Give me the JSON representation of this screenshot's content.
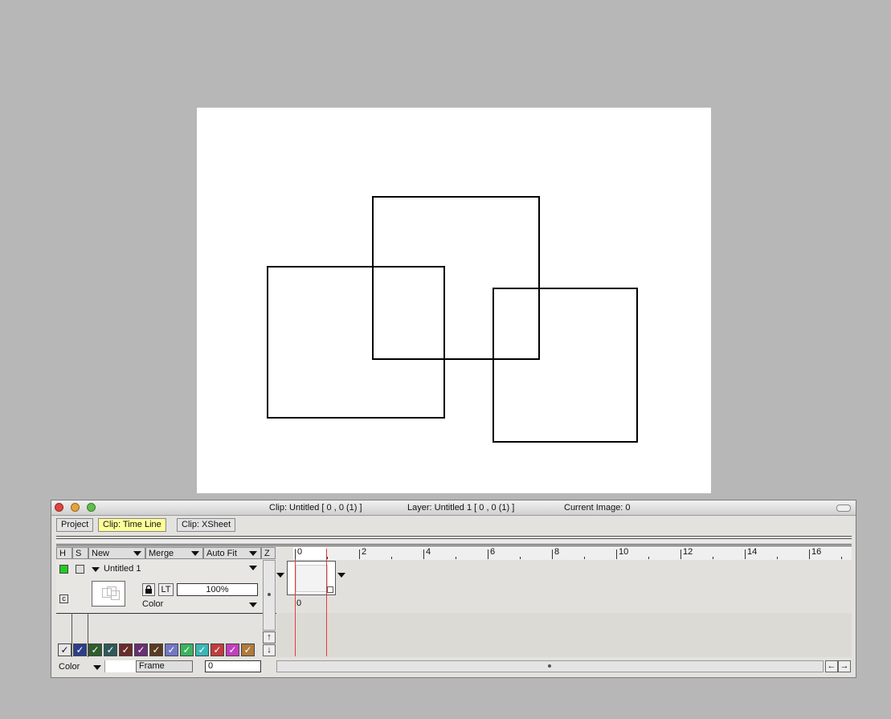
{
  "canvas": {
    "background": "#ffffff",
    "stroke": "#000000"
  },
  "window": {
    "title_clip": "Clip: Untitled [ 0 , 0  (1) ]",
    "title_layer": "Layer: Untitled 1 [ 0 , 0  (1) ]",
    "title_image": "Current Image: 0"
  },
  "tabs": [
    {
      "label": "Project"
    },
    {
      "label": "Clip: Time Line"
    },
    {
      "label": "Clip: XSheet"
    }
  ],
  "columns": {
    "h": "H",
    "s": "S",
    "new": "New",
    "merge": "Merge",
    "autofit": "Auto Fit",
    "z": "Z"
  },
  "layer": {
    "name": "Untitled 1",
    "lock_icon": "lock-icon",
    "lt_label": "LT",
    "opacity": "100%",
    "mode": "Color",
    "c_badge": "c",
    "visible_color": "#22cc22"
  },
  "ruler": {
    "labels": [
      "0",
      "2",
      "4",
      "6",
      "8",
      "10",
      "12",
      "14",
      "16"
    ]
  },
  "cel": {
    "frame_label": "0"
  },
  "swatches": [
    "#e6e6e6",
    "#2c3e8a",
    "#2e5e2e",
    "#2e5a5a",
    "#6a2b2b",
    "#6a2f74",
    "#5a3b22",
    "#7477c4",
    "#3bb360",
    "#3bb6b6",
    "#c23d3d",
    "#c43fbd",
    "#b07a3c"
  ],
  "footer": {
    "mode_label": "Color",
    "frame_label": "Frame",
    "frame_value": "0"
  }
}
